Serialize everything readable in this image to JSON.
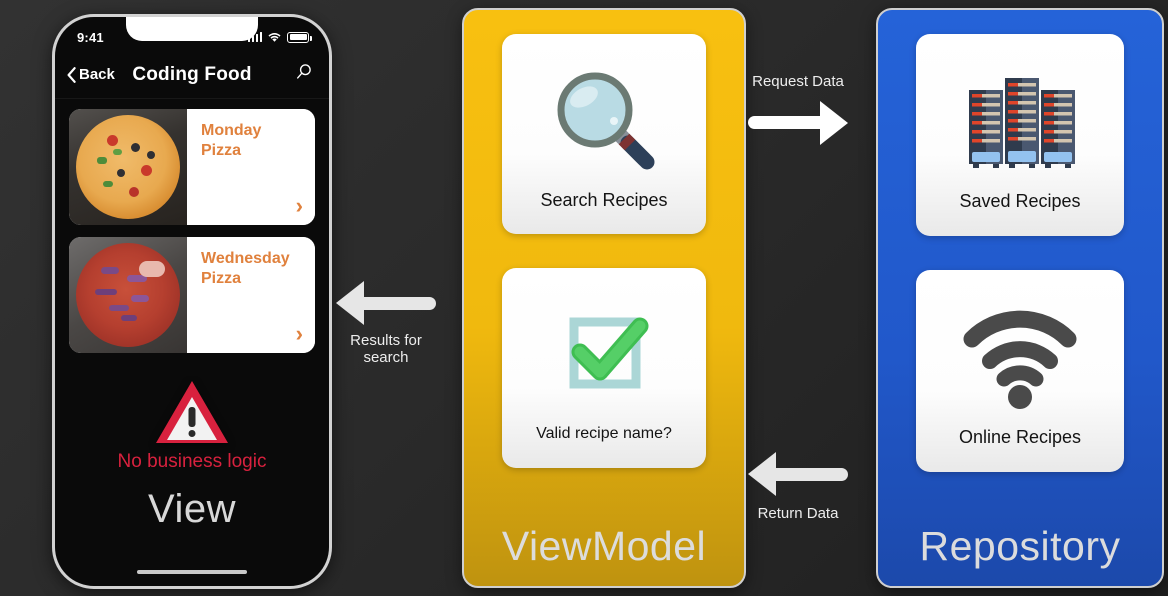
{
  "theme": {
    "background": "#2b2b2b",
    "viewmodel_yellow": "#f8c010",
    "repository_blue": "#2563d8",
    "accent_orange": "#e0813d",
    "warning_red": "#d8213e"
  },
  "view_panel": {
    "title": "View",
    "status_bar": {
      "time": "9:41",
      "signal_icon": "signal-bars-icon",
      "wifi_icon": "wifi-icon",
      "battery_icon": "battery-icon"
    },
    "nav": {
      "back_label": "Back",
      "back_icon": "chevron-left-icon",
      "title": "Coding Food",
      "search_icon": "search-icon"
    },
    "recipes": [
      {
        "name": "Monday Pizza",
        "thumb": "pizza-veggie-image",
        "chevron": "chevron-right-icon"
      },
      {
        "name": "Wednesday Pizza",
        "thumb": "pizza-onion-image",
        "chevron": "chevron-right-icon"
      }
    ],
    "warning": {
      "icon": "warning-triangle-icon",
      "text": "No business logic"
    },
    "home_indicator": "home-indicator"
  },
  "viewmodel_panel": {
    "title": "ViewModel",
    "tiles": [
      {
        "label": "Search Recipes",
        "icon": "magnifying-glass-icon"
      },
      {
        "label": "Valid recipe name?",
        "icon": "green-check-icon"
      }
    ]
  },
  "repository_panel": {
    "title": "Repository",
    "tiles": [
      {
        "label": "Saved Recipes",
        "icon": "server-rack-icon"
      },
      {
        "label": "Online Recipes",
        "icon": "wifi-icon"
      }
    ]
  },
  "connectors": [
    {
      "id": "request",
      "label": "Request Data",
      "direction": "right",
      "icon": "arrow-right-icon"
    },
    {
      "id": "return",
      "label": "Return Data",
      "direction": "left",
      "icon": "arrow-left-icon"
    },
    {
      "id": "results",
      "label": "Results for\nsearch",
      "label_line1": "Results for",
      "label_line2": "search",
      "direction": "left",
      "icon": "arrow-left-icon"
    }
  ]
}
